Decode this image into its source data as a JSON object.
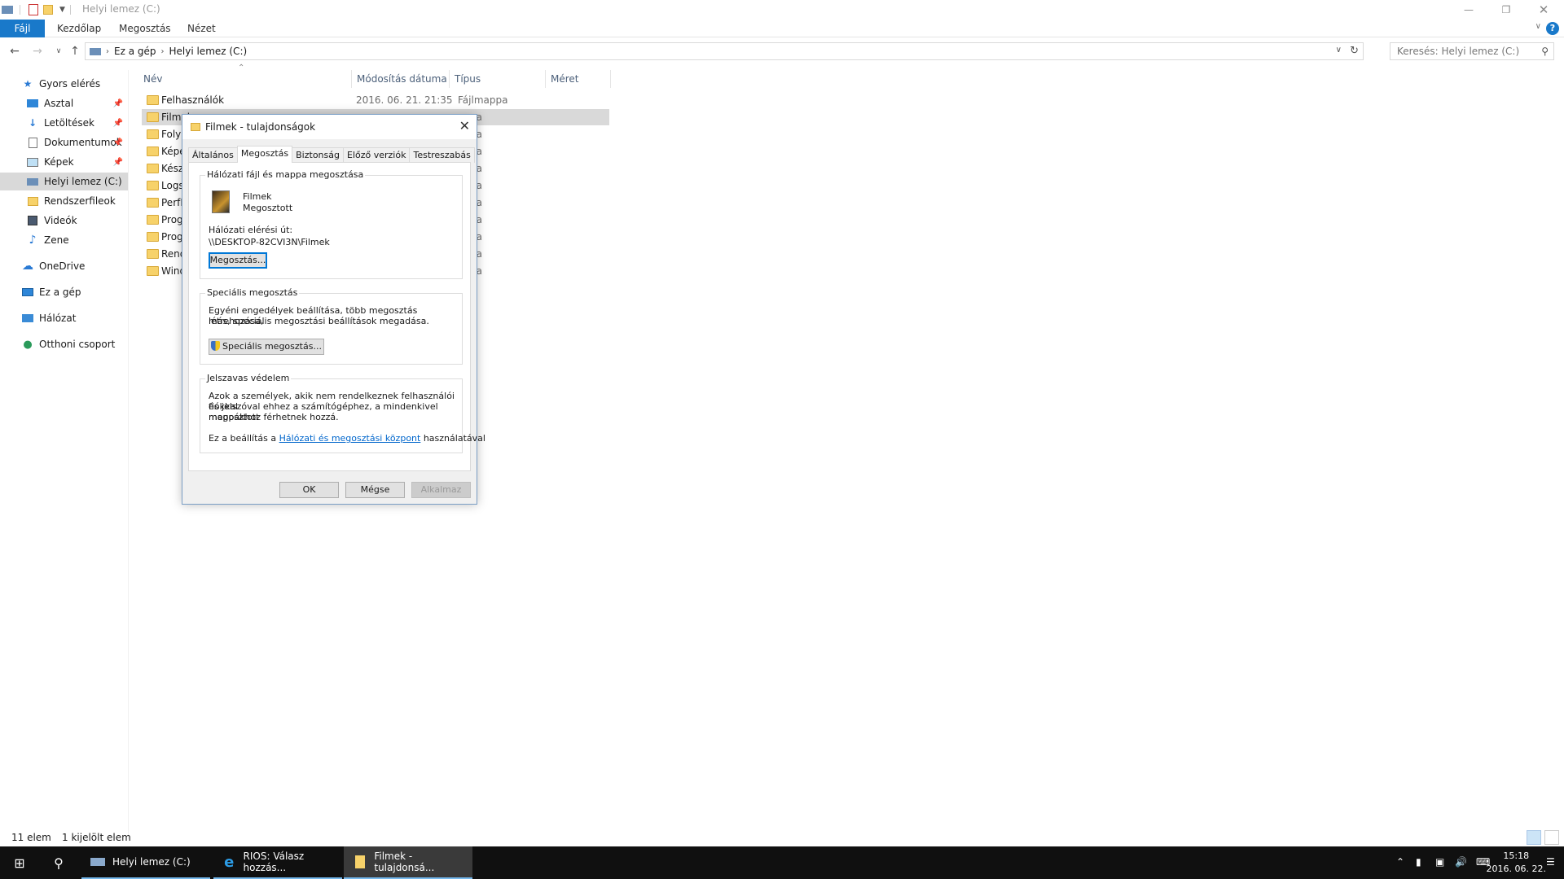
{
  "window": {
    "title": "Helyi lemez (C:)",
    "minimize_icon": "minimize-icon",
    "maximize_icon": "restore-icon",
    "close_icon": "close-icon"
  },
  "ribbon": {
    "tabs": [
      "Fájl",
      "Kezdőlap",
      "Megosztás",
      "Nézet"
    ]
  },
  "address": {
    "crumbs": [
      "Ez a gép",
      "Helyi lemez (C:)"
    ],
    "search_placeholder": "Keresés: Helyi lemez (C:)"
  },
  "navpane": {
    "items": [
      {
        "label": "Gyors elérés",
        "icon": "star-icon"
      },
      {
        "label": "Asztal",
        "icon": "desktop-icon",
        "pinned": true
      },
      {
        "label": "Letöltések",
        "icon": "download-icon",
        "pinned": true
      },
      {
        "label": "Dokumentumok",
        "icon": "document-icon",
        "pinned": true
      },
      {
        "label": "Képek",
        "icon": "pictures-icon",
        "pinned": true
      },
      {
        "label": "Helyi lemez (C:)",
        "icon": "drive-icon",
        "selected": true
      },
      {
        "label": "Rendszerfileok",
        "icon": "folder-icon"
      },
      {
        "label": "Videók",
        "icon": "video-icon"
      },
      {
        "label": "Zene",
        "icon": "music-icon"
      },
      {
        "label": "OneDrive",
        "icon": "cloud-icon"
      },
      {
        "label": "Ez a gép",
        "icon": "computer-icon"
      },
      {
        "label": "Hálózat",
        "icon": "network-icon"
      },
      {
        "label": "Otthoni csoport",
        "icon": "homegroup-icon"
      }
    ]
  },
  "filelist": {
    "columns": [
      "Név",
      "Módosítás dátuma",
      "Típus",
      "Méret"
    ],
    "rows": [
      {
        "name": "Felhasználók",
        "date": "2016. 06. 21. 21:35",
        "type": "Fájlmappa"
      },
      {
        "name": "Filmek",
        "date": "",
        "type": "appa",
        "selected": true
      },
      {
        "name": "Folya",
        "date": "",
        "type": "appa"
      },
      {
        "name": "Képe",
        "date": "",
        "type": "appa"
      },
      {
        "name": "Kész",
        "date": "",
        "type": "appa"
      },
      {
        "name": "Logs",
        "date": "",
        "type": "appa"
      },
      {
        "name": "PerfL",
        "date": "",
        "type": "appa"
      },
      {
        "name": "Prog",
        "date": "",
        "type": "appa"
      },
      {
        "name": "Prog",
        "date": "",
        "type": "appa"
      },
      {
        "name": "Rend",
        "date": "",
        "type": "appa"
      },
      {
        "name": "Wind",
        "date": "",
        "type": "appa"
      }
    ]
  },
  "statusbar": {
    "count": "11 elem",
    "selected": "1 kijelölt elem"
  },
  "dialog": {
    "title": "Filmek - tulajdonságok",
    "tabs": [
      "Általános",
      "Megosztás",
      "Biztonság",
      "Előző verziók",
      "Testreszabás"
    ],
    "active_tab": "Megosztás",
    "network_group": {
      "legend": "Hálózati fájl és mappa megosztása",
      "folder_name": "Filmek",
      "folder_status": "Megosztott",
      "path_label": "Hálózati elérési út:",
      "path_value": "\\\\DESKTOP-82CVI3N\\Filmek",
      "share_button": "Megosztás..."
    },
    "advanced_group": {
      "legend": "Speciális megosztás",
      "desc_line1": "Egyéni engedélyek beállítása, több megosztás létrehozása,",
      "desc_line2": "más, speciális megosztási beállítások megadása.",
      "button": "Speciális megosztás..."
    },
    "password_group": {
      "legend": "Jelszavas védelem",
      "desc_line1": "Azok a személyek, akik nem rendelkeznek felhasználói fiókkal",
      "desc_line2": "és jelszóval ehhez a számítógéphez, a mindenkivel megosztott",
      "desc_line3": "mappákhoz férhetnek hozzá.",
      "setting_prefix": "Ez a beállítás a ",
      "setting_link": "Hálózati és megosztási központ",
      "setting_suffix": " használatával"
    },
    "ok": "OK",
    "cancel": "Mégse",
    "apply": "Alkalmaz"
  },
  "taskbar": {
    "items": [
      {
        "label": "Helyi lemez (C:)",
        "icon": "explorer-icon"
      },
      {
        "label": "RIOS: Válasz hozzás...",
        "icon": "internet-explorer-icon"
      },
      {
        "label": "Filmek - tulajdonsá...",
        "icon": "folder-icon",
        "active": true
      }
    ],
    "time": "15:18",
    "date": "2016. 06. 22."
  }
}
